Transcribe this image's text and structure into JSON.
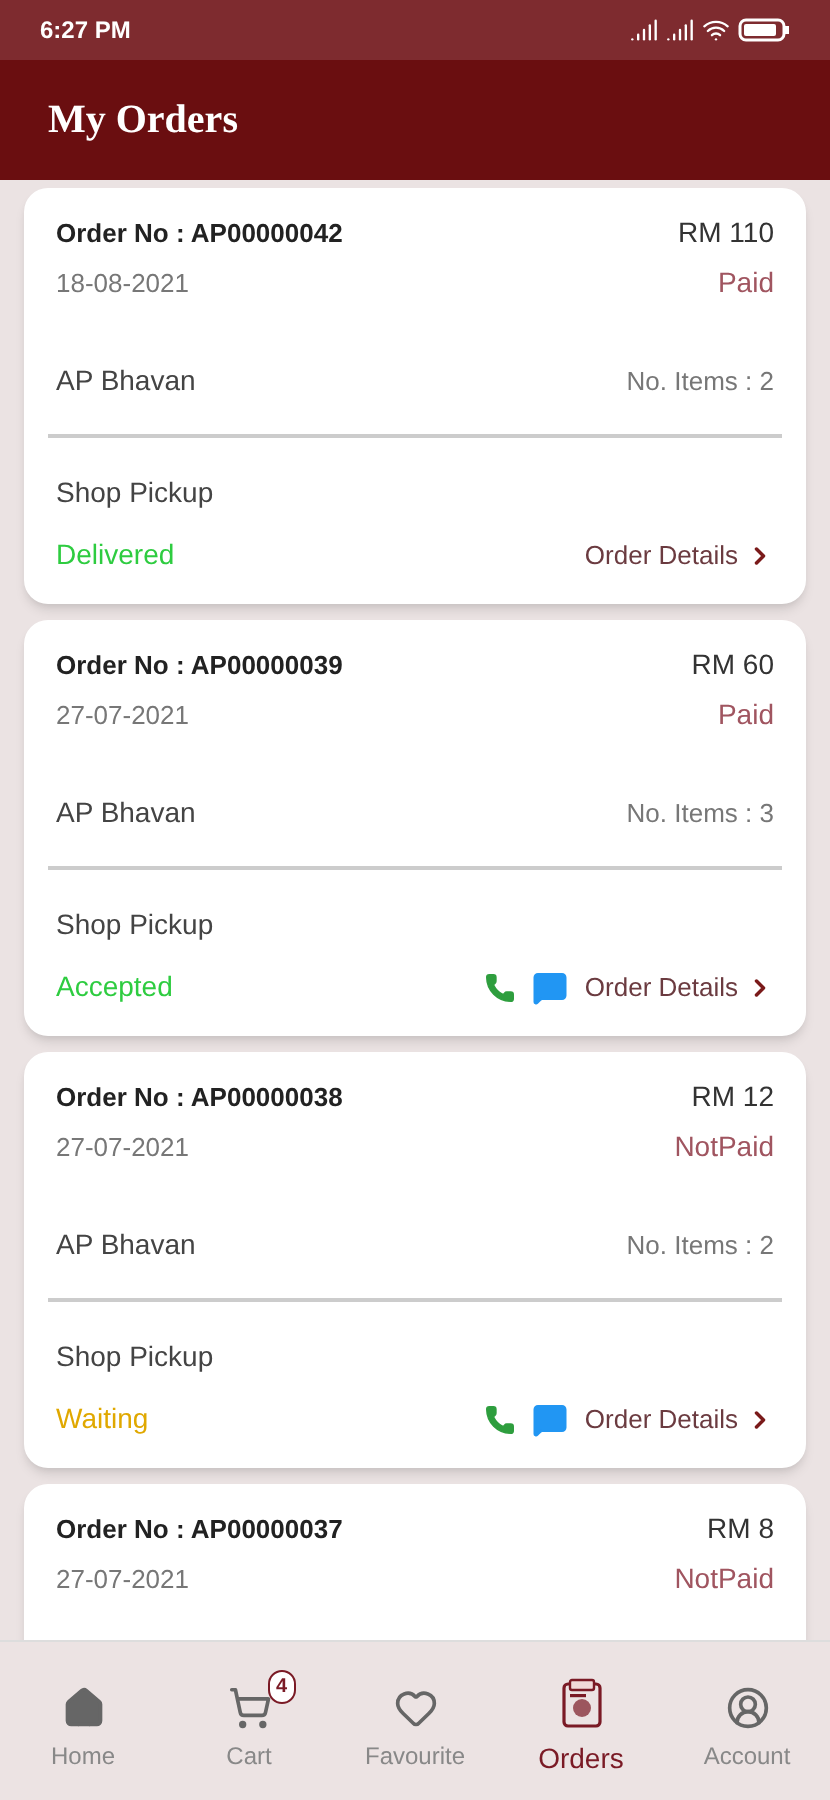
{
  "status_bar": {
    "time": "6:27 PM"
  },
  "header": {
    "title": "My Orders"
  },
  "orders": [
    {
      "order_label": "Order No : AP00000042",
      "date": "18-08-2021",
      "amount": "RM 110",
      "payment": "Paid",
      "shop": "AP Bhavan",
      "items": "No. Items : 2",
      "delivery": "Shop Pickup",
      "status": "Delivered",
      "color": "#2ecc40",
      "contact_actions": false,
      "details": "Order Details"
    },
    {
      "order_label": "Order No : AP00000039",
      "date": "27-07-2021",
      "amount": "RM 60",
      "payment": "Paid",
      "shop": "AP Bhavan",
      "items": "No. Items : 3",
      "delivery": "Shop Pickup",
      "status": "Accepted",
      "color": "#2ecc40",
      "contact_actions": true,
      "details": "Order Details"
    },
    {
      "order_label": "Order No : AP00000038",
      "date": "27-07-2021",
      "amount": "RM 12",
      "payment": "NotPaid",
      "shop": "AP Bhavan",
      "items": "No. Items : 2",
      "delivery": "Shop Pickup",
      "status": "Waiting",
      "color": "#e0a800",
      "contact_actions": true,
      "details": "Order Details"
    },
    {
      "order_label": "Order No : AP00000037",
      "date": "27-07-2021",
      "amount": "RM 8",
      "payment": "NotPaid"
    }
  ],
  "nav": [
    {
      "kind": "home",
      "label": "Home",
      "selected": false
    },
    {
      "kind": "cart",
      "label": "Cart",
      "badge": "4",
      "selected": false
    },
    {
      "kind": "favourite",
      "label": "Favourite",
      "selected": false
    },
    {
      "kind": "orders",
      "label": "Orders",
      "selected": true
    },
    {
      "kind": "account",
      "label": "Account",
      "selected": false
    }
  ]
}
